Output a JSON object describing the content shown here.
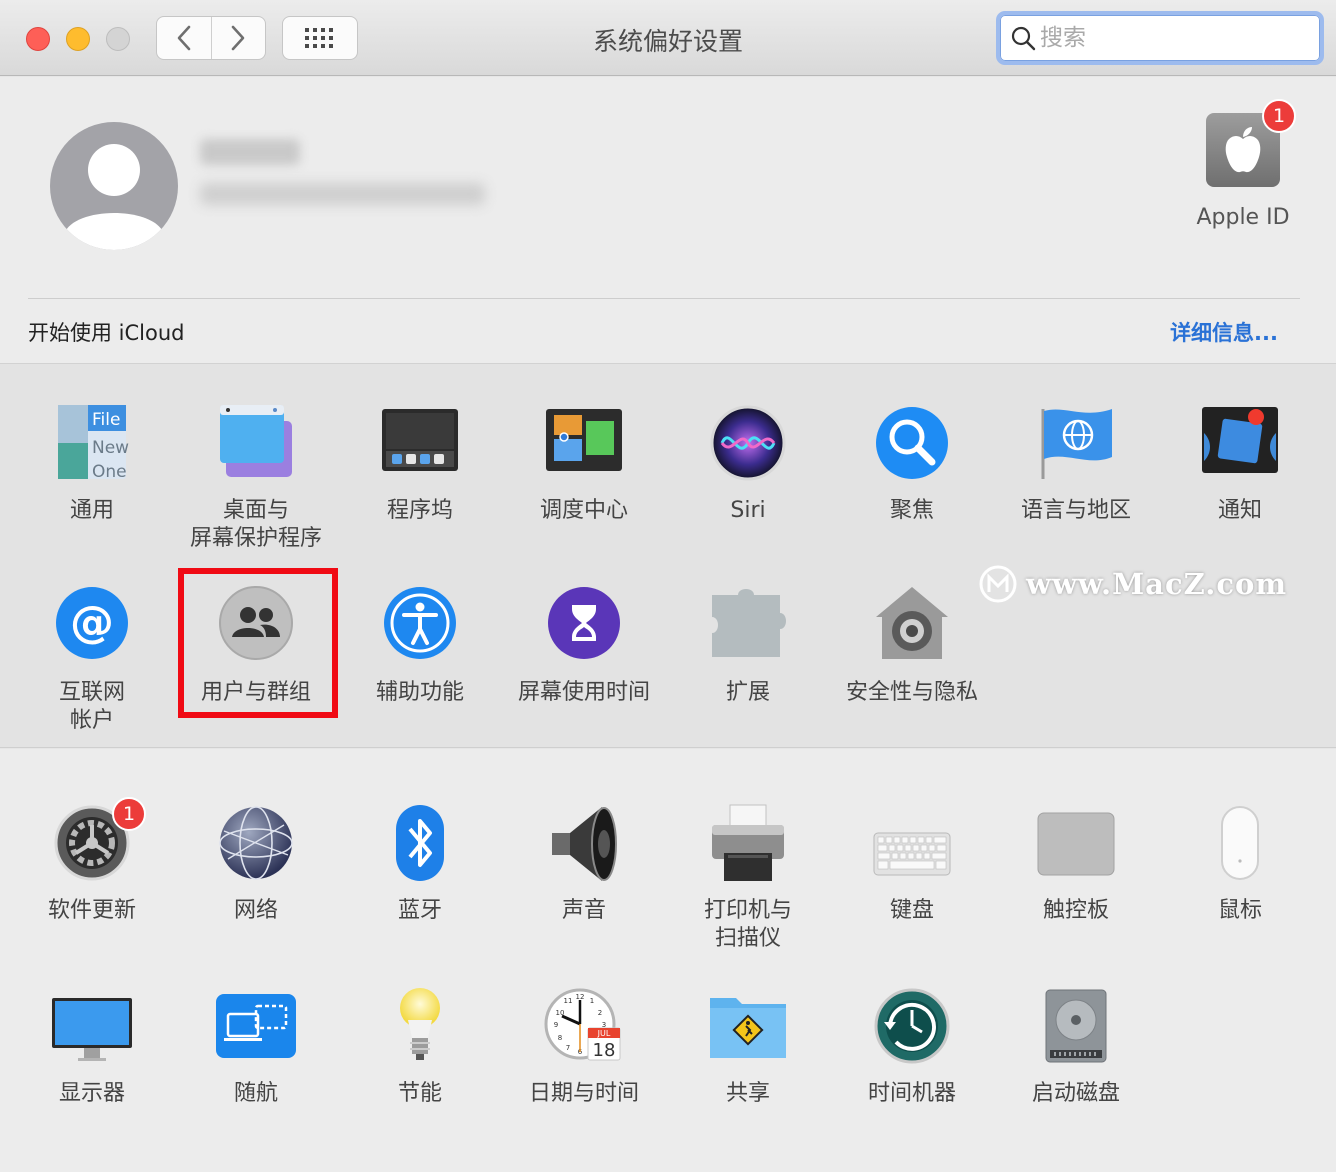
{
  "window": {
    "title": "系统偏好设置",
    "search": {
      "placeholder": "搜索",
      "value": ""
    }
  },
  "account": {
    "apple_id": {
      "label": "Apple ID",
      "badge": "1"
    },
    "icloud_prompt": "开始使用 iCloud",
    "details_link": "详细信息..."
  },
  "prefs_row1": [
    {
      "label": "通用",
      "icon": "general-icon"
    },
    {
      "label": "桌面与\n屏幕保护程序",
      "icon": "desktop-screensaver-icon"
    },
    {
      "label": "程序坞",
      "icon": "dock-icon"
    },
    {
      "label": "调度中心",
      "icon": "mission-control-icon"
    },
    {
      "label": "Siri",
      "icon": "siri-icon"
    },
    {
      "label": "聚焦",
      "icon": "spotlight-icon"
    },
    {
      "label": "语言与地区",
      "icon": "language-region-icon"
    },
    {
      "label": "通知",
      "icon": "notifications-icon"
    }
  ],
  "prefs_row2": [
    {
      "label": "互联网\n帐户",
      "icon": "internet-accounts-icon"
    },
    {
      "label": "用户与群组",
      "icon": "users-groups-icon",
      "highlighted": true
    },
    {
      "label": "辅助功能",
      "icon": "accessibility-icon"
    },
    {
      "label": "屏幕使用时间",
      "icon": "screen-time-icon"
    },
    {
      "label": "扩展",
      "icon": "extensions-icon"
    },
    {
      "label": "安全性与隐私",
      "icon": "security-privacy-icon"
    }
  ],
  "prefs_row3": [
    {
      "label": "软件更新",
      "icon": "software-update-icon",
      "badge": "1"
    },
    {
      "label": "网络",
      "icon": "network-icon"
    },
    {
      "label": "蓝牙",
      "icon": "bluetooth-icon"
    },
    {
      "label": "声音",
      "icon": "sound-icon"
    },
    {
      "label": "打印机与\n扫描仪",
      "icon": "printers-scanners-icon"
    },
    {
      "label": "键盘",
      "icon": "keyboard-icon"
    },
    {
      "label": "触控板",
      "icon": "trackpad-icon"
    },
    {
      "label": "鼠标",
      "icon": "mouse-icon"
    }
  ],
  "prefs_row4": [
    {
      "label": "显示器",
      "icon": "displays-icon"
    },
    {
      "label": "随航",
      "icon": "sidecar-icon"
    },
    {
      "label": "节能",
      "icon": "energy-saver-icon"
    },
    {
      "label": "日期与时间",
      "icon": "date-time-icon"
    },
    {
      "label": "共享",
      "icon": "sharing-icon"
    },
    {
      "label": "时间机器",
      "icon": "time-machine-icon"
    },
    {
      "label": "启动磁盘",
      "icon": "startup-disk-icon"
    }
  ],
  "date_icon": {
    "month": "JUL",
    "day": "18"
  },
  "general_icon_text": [
    "File",
    "New",
    "One"
  ],
  "watermark": "www.MacZ.com",
  "colors": {
    "accent": "#2a72d6",
    "highlight": "#f00a14",
    "badge": "#ec3c3a"
  }
}
